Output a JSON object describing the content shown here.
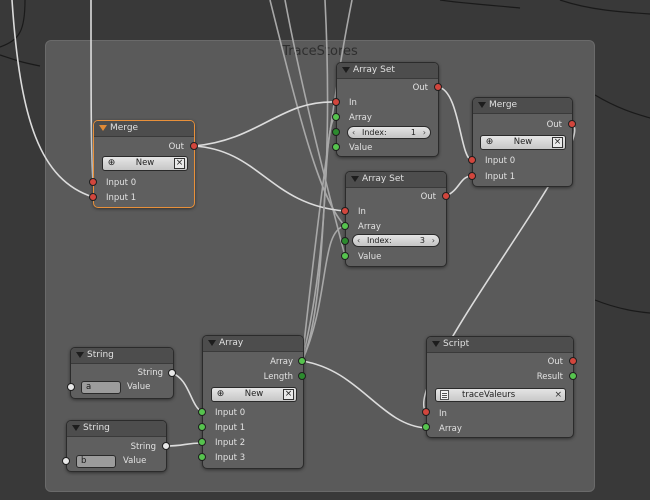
{
  "frame": {
    "title": "TraceStores"
  },
  "nodes": {
    "merge1": {
      "title": "Merge",
      "out": "Out",
      "new_label": "New",
      "in0": "Input 0",
      "in1": "Input 1"
    },
    "arrayset1": {
      "title": "Array Set",
      "out": "Out",
      "in": "In",
      "array": "Array",
      "index_label": "Index:",
      "index_value": "1",
      "value": "Value"
    },
    "arrayset2": {
      "title": "Array Set",
      "out": "Out",
      "in": "In",
      "array": "Array",
      "index_label": "Index:",
      "index_value": "3",
      "value": "Value"
    },
    "merge2": {
      "title": "Merge",
      "out": "Out",
      "new_label": "New",
      "in0": "Input 0",
      "in1": "Input 1"
    },
    "string1": {
      "title": "String",
      "out": "String",
      "text": "a",
      "value": "Value"
    },
    "string2": {
      "title": "String",
      "out": "String",
      "text": "b",
      "value": "Value"
    },
    "array": {
      "title": "Array",
      "out_array": "Array",
      "out_length": "Length",
      "new_label": "New",
      "in0": "Input 0",
      "in1": "Input 1",
      "in2": "Input 2",
      "in3": "Input 3"
    },
    "script": {
      "title": "Script",
      "out": "Out",
      "result": "Result",
      "script_name": "traceValeurs",
      "in": "In",
      "array": "Array"
    }
  },
  "colors": {
    "socket_data": "#d2463d",
    "socket_array": "#56c34e",
    "socket_string": "#e8e8e8",
    "selected_outline": "#e8903a"
  }
}
